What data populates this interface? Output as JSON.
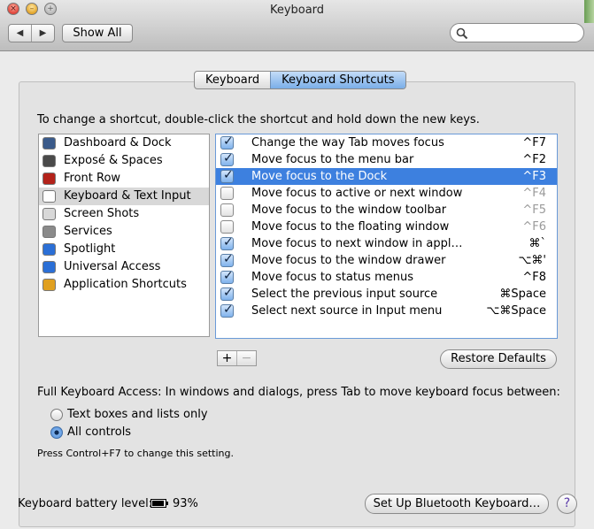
{
  "window": {
    "title": "Keyboard",
    "traffic": {
      "close": "×",
      "minimize": "–",
      "zoom": "+"
    }
  },
  "toolbar": {
    "back_glyph": "◀",
    "forward_glyph": "▶",
    "show_all_label": "Show All",
    "search_placeholder": "",
    "icons": {
      "search": "search-icon"
    }
  },
  "tabs": [
    {
      "label": "Keyboard",
      "active": false
    },
    {
      "label": "Keyboard Shortcuts",
      "active": true
    }
  ],
  "instruction": "To change a shortcut, double-click the shortcut and hold down the new keys.",
  "categories": [
    {
      "label": "Dashboard & Dock",
      "icon": "dashboard-dock-icon",
      "color": "#3a5a8a",
      "selected": false
    },
    {
      "label": "Exposé & Spaces",
      "icon": "expose-spaces-icon",
      "color": "#4a4a4a",
      "selected": false
    },
    {
      "label": "Front Row",
      "icon": "front-row-icon",
      "color": "#b3221a",
      "selected": false
    },
    {
      "label": "Keyboard & Text Input",
      "icon": "keyboard-text-input-icon",
      "color": "#ffffff",
      "selected": true
    },
    {
      "label": "Screen Shots",
      "icon": "screen-shots-icon",
      "color": "#d8d8d8",
      "selected": false
    },
    {
      "label": "Services",
      "icon": "services-icon",
      "color": "#8a8a8a",
      "selected": false
    },
    {
      "label": "Spotlight",
      "icon": "spotlight-icon",
      "color": "#2b6fd6",
      "selected": false
    },
    {
      "label": "Universal Access",
      "icon": "universal-access-icon",
      "color": "#2b6fd6",
      "selected": false
    },
    {
      "label": "Application Shortcuts",
      "icon": "application-shortcuts-icon",
      "color": "#e0a020",
      "selected": false
    }
  ],
  "shortcuts": [
    {
      "description": "Change the way Tab moves focus",
      "keys": "^F7",
      "checked": true,
      "selected": false
    },
    {
      "description": "Move focus to the menu bar",
      "keys": "^F2",
      "checked": true,
      "selected": false
    },
    {
      "description": "Move focus to the Dock",
      "keys": "^F3",
      "checked": true,
      "selected": true
    },
    {
      "description": "Move focus to active or next window",
      "keys": "^F4",
      "checked": false,
      "selected": false
    },
    {
      "description": "Move focus to the window toolbar",
      "keys": "^F5",
      "checked": false,
      "selected": false
    },
    {
      "description": "Move focus to the floating window",
      "keys": "^F6",
      "checked": false,
      "selected": false
    },
    {
      "description": "Move focus to next window in appl…",
      "keys": "⌘`",
      "checked": true,
      "selected": false
    },
    {
      "description": "Move focus to the window drawer",
      "keys": "⌥⌘'",
      "checked": true,
      "selected": false
    },
    {
      "description": "Move focus to status menus",
      "keys": "^F8",
      "checked": true,
      "selected": false
    },
    {
      "description": "Select the previous input source",
      "keys": "⌘Space",
      "checked": true,
      "selected": false
    },
    {
      "description": "Select next source in Input menu",
      "keys": "⌥⌘Space",
      "checked": true,
      "selected": false
    }
  ],
  "list_controls": {
    "add": "+",
    "remove": "−"
  },
  "restore_defaults_label": "Restore Defaults",
  "full_keyboard_access": {
    "label": "Full Keyboard Access: In windows and dialogs, press Tab to move keyboard focus between:",
    "options": [
      {
        "label": "Text boxes and lists only",
        "selected": false
      },
      {
        "label": "All controls",
        "selected": true
      }
    ],
    "note": "Press Control+F7 to change this setting."
  },
  "battery": {
    "label": "Keyboard battery level:",
    "value": "93%",
    "level": 0.93,
    "icon": "battery-icon"
  },
  "bluetooth_button_label": "Set Up Bluetooth Keyboard…",
  "help_label": "?",
  "colors": {
    "selection": "#3d80df",
    "accent": "#7aaee8"
  }
}
